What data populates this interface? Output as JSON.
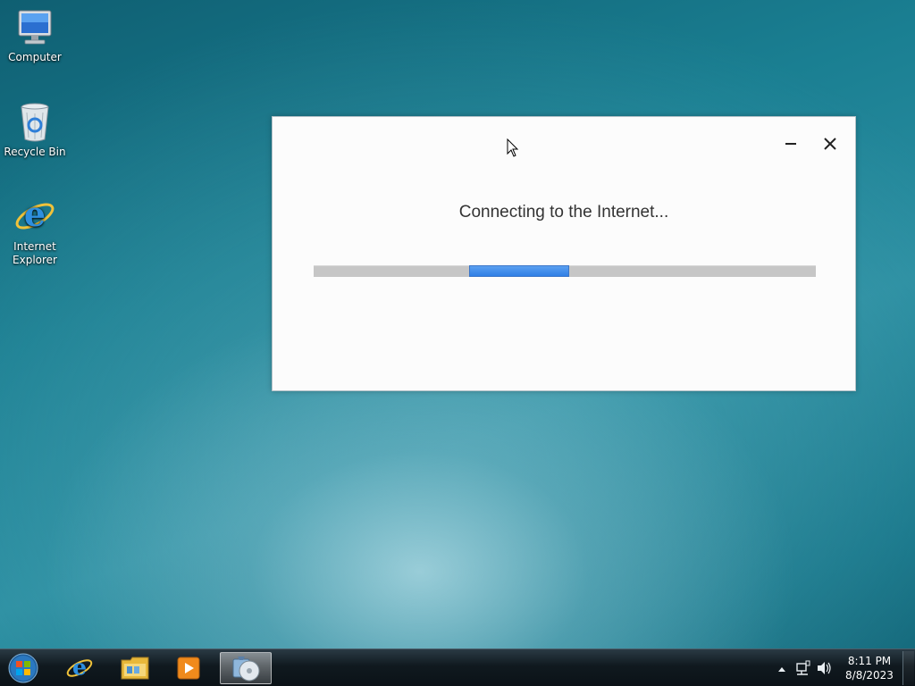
{
  "desktop": {
    "icons": [
      {
        "label": "Computer",
        "icon": "computer-icon"
      },
      {
        "label": "Recycle Bin",
        "icon": "recycle-bin-icon"
      },
      {
        "label": "Internet\nExplorer",
        "label_line1": "Internet",
        "label_line2": "Explorer",
        "icon": "internet-explorer-icon"
      }
    ]
  },
  "dialog": {
    "status_text": "Connecting to the Internet...",
    "progress": {
      "segment_start_percent": 31,
      "segment_width_percent": 20,
      "indeterminate": true
    },
    "colors": {
      "progress_fill": "#3b86e8",
      "progress_track": "#c6c6c6"
    }
  },
  "taskbar": {
    "items": [
      "start-orb-icon",
      "internet-explorer-icon",
      "file-explorer-icon",
      "media-player-icon",
      "dvd-maker-icon"
    ],
    "clock": {
      "time": "8:11 PM",
      "date": "8/8/2023"
    }
  }
}
